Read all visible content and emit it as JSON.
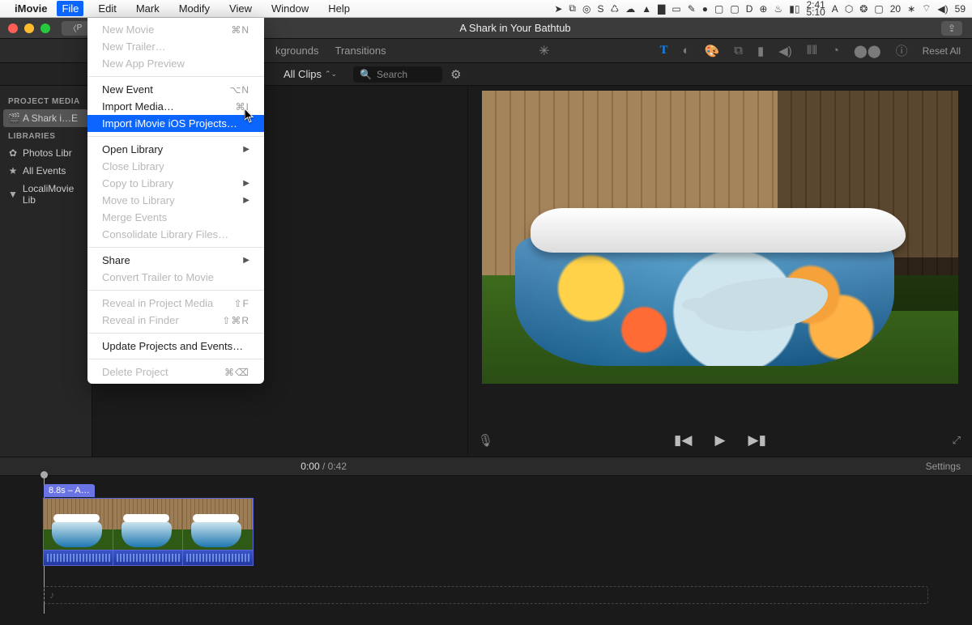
{
  "menubar": {
    "app": "iMovie",
    "items": [
      "File",
      "Edit",
      "Mark",
      "Modify",
      "View",
      "Window",
      "Help"
    ],
    "clock_time": "2:41",
    "clock_sub": "5:10",
    "status_right": "59"
  },
  "dropdown": {
    "new_movie": "New Movie",
    "new_movie_sc": "⌘N",
    "new_trailer": "New Trailer…",
    "new_app_preview": "New App Preview",
    "new_event": "New Event",
    "new_event_sc": "⌥N",
    "import_media": "Import Media…",
    "import_media_sc": "⌘I",
    "import_ios": "Import iMovie iOS Projects…",
    "open_library": "Open Library",
    "close_library": "Close Library",
    "copy_to_library": "Copy to Library",
    "move_to_library": "Move to Library",
    "merge_events": "Merge Events",
    "consolidate": "Consolidate Library Files…",
    "share": "Share",
    "convert_trailer": "Convert Trailer to Movie",
    "reveal_project": "Reveal in Project Media",
    "reveal_project_sc": "⇧F",
    "reveal_finder": "Reveal in Finder",
    "reveal_finder_sc": "⇧⌘R",
    "update_projects": "Update Projects and Events…",
    "delete_project": "Delete Project",
    "delete_project_sc": "⌘⌫"
  },
  "window": {
    "title": "A Shark in Your Bathtub",
    "back_label": "P"
  },
  "tabs": {
    "backgrounds": "kgrounds",
    "transitions": "Transitions"
  },
  "filter": {
    "all_clips": "All Clips",
    "search_placeholder": "Search"
  },
  "sidebar": {
    "project_media": "PROJECT MEDIA",
    "project_name": "A Shark i…E",
    "libraries": "LIBRARIES",
    "photos": "Photos Libr",
    "all_events": "All Events",
    "local": "LocaliMovie Lib"
  },
  "viewer": {
    "reset": "Reset All"
  },
  "timeline": {
    "current": "0:00",
    "total": "0:42",
    "settings": "Settings",
    "clip_label": "8.8s – A…"
  }
}
